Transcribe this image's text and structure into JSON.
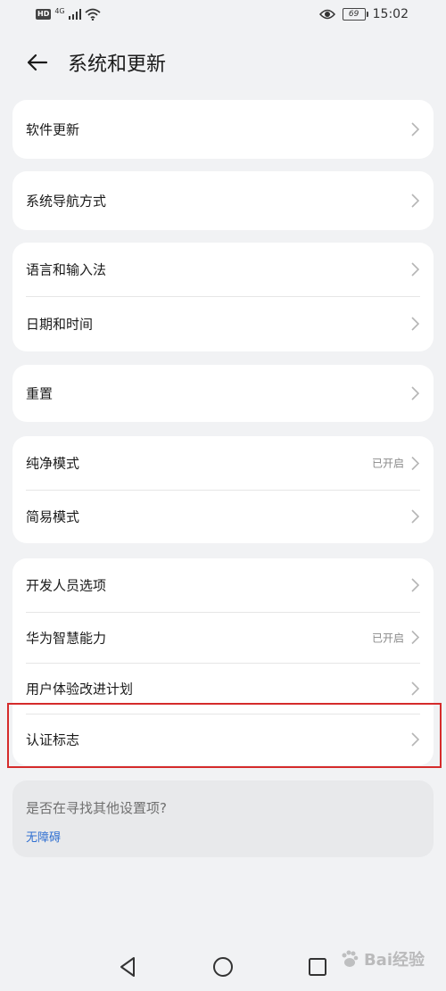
{
  "status_bar": {
    "hd": "HD",
    "network": "4G",
    "battery_level": "69",
    "time": "15:02"
  },
  "header": {
    "title": "系统和更新"
  },
  "groups": [
    {
      "items": [
        {
          "label": "软件更新",
          "status": ""
        }
      ]
    },
    {
      "items": [
        {
          "label": "系统导航方式",
          "status": ""
        }
      ]
    },
    {
      "items": [
        {
          "label": "语言和输入法",
          "status": ""
        },
        {
          "label": "日期和时间",
          "status": ""
        }
      ]
    },
    {
      "items": [
        {
          "label": "重置",
          "status": ""
        }
      ]
    },
    {
      "items": [
        {
          "label": "纯净模式",
          "status": "已开启"
        },
        {
          "label": "简易模式",
          "status": ""
        }
      ]
    },
    {
      "items": [
        {
          "label": "开发人员选项",
          "status": ""
        },
        {
          "label": "华为智慧能力",
          "status": "已开启"
        },
        {
          "label": "用户体验改进计划",
          "status": ""
        },
        {
          "label": "认证标志",
          "status": ""
        }
      ]
    }
  ],
  "search_suggestion": {
    "question": "是否在寻找其他设置项?",
    "link": "无障碍"
  },
  "watermark": {
    "text": "Bai经验"
  },
  "colors": {
    "background": "#f1f2f4",
    "card": "#ffffff",
    "link": "#2f6fd1",
    "highlight": "#d52b2b"
  }
}
